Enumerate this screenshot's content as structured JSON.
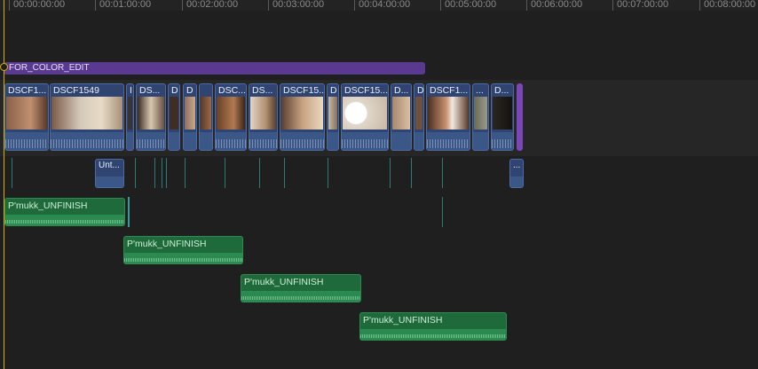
{
  "ruler": {
    "ticks": [
      "00:00:00:00",
      "00:01:00:00",
      "00:02:00:00",
      "00:03:00:00",
      "00:04:00:00",
      "00:05:00:00",
      "00:06:00:00",
      "00:07:00:00",
      "00:08:00:00"
    ]
  },
  "role": {
    "label": "FOR_COLOR_EDIT",
    "color": "#5a3a90"
  },
  "clips": [
    {
      "title": "DSCF1...",
      "thumb": "#7a5640"
    },
    {
      "title": "DSCF1549",
      "thumb": "#b8a890"
    },
    {
      "title": "I",
      "thumb": "#3a3530"
    },
    {
      "title": "DS...",
      "thumb": "#6a5040"
    },
    {
      "title": "D",
      "thumb": "#402e25"
    },
    {
      "title": "D",
      "thumb": "#907060"
    },
    {
      "title": "",
      "thumb": "#5a3a28"
    },
    {
      "title": "DSC...",
      "thumb": "#8a5c3a"
    },
    {
      "title": "DS...",
      "thumb": "#b29070"
    },
    {
      "title": "DSCF15...",
      "thumb": "#9a7050"
    },
    {
      "title": "D",
      "thumb": "#c4b8a8"
    },
    {
      "title": "DSCF15...",
      "thumb": "#d8d0c4"
    },
    {
      "title": "D...",
      "thumb": "#a88870"
    },
    {
      "title": "D",
      "thumb": "#705040"
    },
    {
      "title": "DSCF1...",
      "thumb": "#8a5a40"
    },
    {
      "title": "...",
      "thumb": "#6a6a5a"
    },
    {
      "title": "D...",
      "thumb": "#2a2620"
    }
  ],
  "connected": [
    {
      "title": "Unt..."
    },
    {
      "title": "..."
    }
  ],
  "audio": [
    {
      "title": "P'mukk_UNFINISH"
    },
    {
      "title": "P'mukk_UNFINISH"
    },
    {
      "title": "P'mukk_UNFINISH"
    },
    {
      "title": "P'mukk_UNFINISH"
    }
  ]
}
